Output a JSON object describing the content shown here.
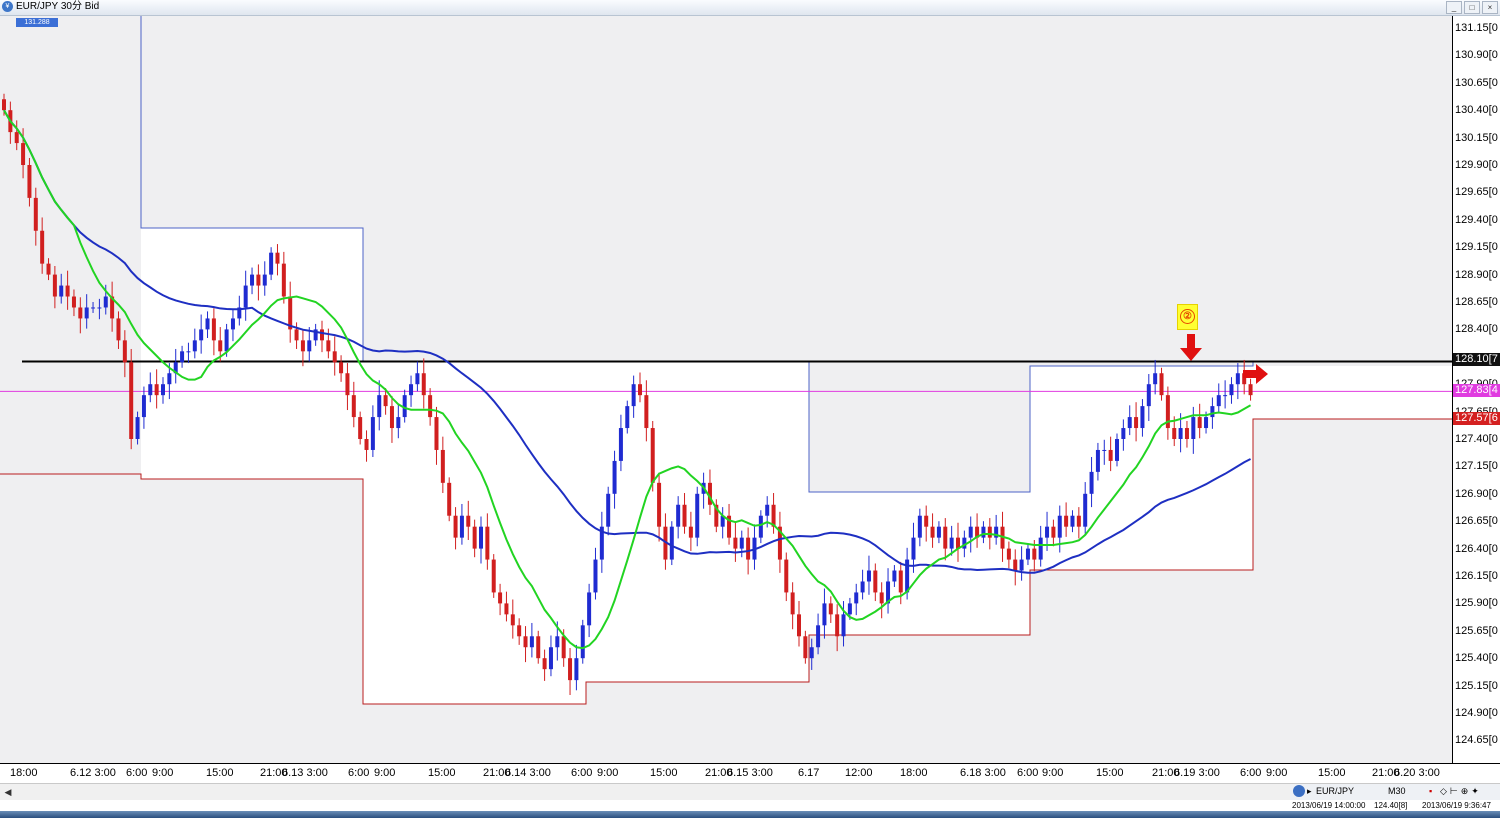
{
  "window": {
    "title": "EUR/JPY 30分 Bid",
    "icon": "currency-globe-icon",
    "buttons": [
      "min-icon",
      "max-icon",
      "close-icon"
    ]
  },
  "info_box": "131.288",
  "price_axis": {
    "labels": [
      "131.15[0",
      "130.90[0",
      "130.65[0",
      "130.40[0",
      "130.15[0",
      "129.90[0",
      "129.65[0",
      "129.40[0",
      "129.15[0",
      "128.90[0",
      "128.65[0",
      "128.40[0",
      "127.90[0",
      "127.65[0",
      "127.40[0",
      "127.15[0",
      "126.90[0",
      "126.65[0",
      "126.40[0",
      "126.15[0",
      "125.90[0",
      "125.65[0",
      "125.40[0",
      "125.15[0",
      "124.90[0",
      "124.65[0",
      "124.40[0"
    ],
    "tag_black": "128.10[7",
    "tag_magenta": "127.83[4",
    "tag_red": "127.57[6"
  },
  "time_axis": [
    "18:00",
    "6.12 3:00",
    "6:00",
    "9:00",
    "15:00",
    "21:00",
    "6.13 3:00",
    "6:00",
    "9:00",
    "15:00",
    "21:00",
    "6.14 3:00",
    "6:00",
    "9:00",
    "15:00",
    "21:00",
    "6.15 3:00",
    "6.17",
    "12:00",
    "18:00",
    "6.18 3:00",
    "6:00",
    "9:00",
    "15:00",
    "21:00",
    "6.19 3:00",
    "6:00",
    "9:00",
    "15:00",
    "21:00",
    "6.20 3:00"
  ],
  "annotation": {
    "marker": "②"
  },
  "status": {
    "symbol": "EUR/JPY",
    "timeframe": "M30",
    "left_info": "2013/06/19 14:00:00",
    "mid_info": "124.40[8]",
    "right_info": "2013/06/19 9:36:47"
  },
  "colors": {
    "bull": "#1f2bd1",
    "bear": "#d11f1f",
    "ma_fast": "#22d422",
    "ma_slow": "#1e2fc2",
    "box_blue": "#4d63c7",
    "box_red": "#b81e1e",
    "resistance": "#000000",
    "current": "#e03ce0",
    "grey_bg": "#efeff1"
  },
  "chart_data": {
    "type": "candlestick",
    "title": "EUR/JPY 30分 Bid",
    "ylim": [
      124.4,
      131.28
    ],
    "ticks": [
      "18:00",
      "6.12 3:00",
      "6:00",
      "9:00",
      "15:00",
      "21:00",
      "6.13 3:00",
      "6:00",
      "9:00",
      "15:00",
      "21:00",
      "6.14 3:00",
      "6:00",
      "9:00",
      "15:00",
      "21:00",
      "6.15 3:00",
      "6.17",
      "12:00",
      "18:00",
      "6.18 3:00",
      "6:00",
      "9:00",
      "15:00",
      "21:00",
      "6.19 3:00",
      "6:00",
      "9:00",
      "15:00",
      "21:00",
      "6.20 3:00"
    ],
    "resistance_level": 128.107,
    "current_price": 127.834,
    "low_price": 127.576,
    "close": [
      130.4,
      130.2,
      130.1,
      129.9,
      129.6,
      129.3,
      129.0,
      128.9,
      128.7,
      128.8,
      128.7,
      128.6,
      128.5,
      128.6,
      128.6,
      128.6,
      128.7,
      128.5,
      128.3,
      128.1,
      127.4,
      127.6,
      127.8,
      127.9,
      127.8,
      127.9,
      128.0,
      128.1,
      128.2,
      128.2,
      128.3,
      128.4,
      128.5,
      128.3,
      128.2,
      128.4,
      128.5,
      128.6,
      128.8,
      128.9,
      128.8,
      128.9,
      129.1,
      129.0,
      128.7,
      128.4,
      128.3,
      128.2,
      128.3,
      128.4,
      128.3,
      128.2,
      128.1,
      128.0,
      127.8,
      127.6,
      127.4,
      127.3,
      127.6,
      127.8,
      127.7,
      127.5,
      127.6,
      127.8,
      127.9,
      128.0,
      127.8,
      127.6,
      127.3,
      127.0,
      126.7,
      126.5,
      126.7,
      126.6,
      126.4,
      126.6,
      126.3,
      126.0,
      125.9,
      125.8,
      125.7,
      125.6,
      125.5,
      125.6,
      125.4,
      125.3,
      125.5,
      125.6,
      125.4,
      125.2,
      125.4,
      125.7,
      126.0,
      126.3,
      126.6,
      126.9,
      127.2,
      127.5,
      127.7,
      127.9,
      127.8,
      127.5,
      127.0,
      126.6,
      126.3,
      126.6,
      126.8,
      126.6,
      126.5,
      126.9,
      127.0,
      126.8,
      126.6,
      126.7,
      126.5,
      126.4,
      126.5,
      126.3,
      126.5,
      126.7,
      126.8,
      126.6,
      126.3,
      126.0,
      125.8,
      125.6,
      125.4,
      125.5,
      125.7,
      125.9,
      125.8,
      125.6,
      125.8,
      125.9,
      126.0,
      126.1,
      126.2,
      126.0,
      125.9,
      126.1,
      126.2,
      126.0,
      126.3,
      126.5,
      126.7,
      126.6,
      126.5,
      126.6,
      126.4,
      126.5,
      126.4,
      126.5,
      126.6,
      126.5,
      126.6,
      126.5,
      126.6,
      126.4,
      126.3,
      126.2,
      126.3,
      126.4,
      126.3,
      126.5,
      126.6,
      126.5,
      126.7,
      126.6,
      126.7,
      126.6,
      126.9,
      127.1,
      127.3,
      127.3,
      127.2,
      127.4,
      127.5,
      127.6,
      127.5,
      127.7,
      127.9,
      128.0,
      127.8,
      127.5,
      127.4,
      127.5,
      127.4,
      127.6,
      127.5,
      127.6,
      127.7,
      127.8,
      127.8,
      127.9,
      128.0,
      127.9,
      127.8
    ]
  }
}
